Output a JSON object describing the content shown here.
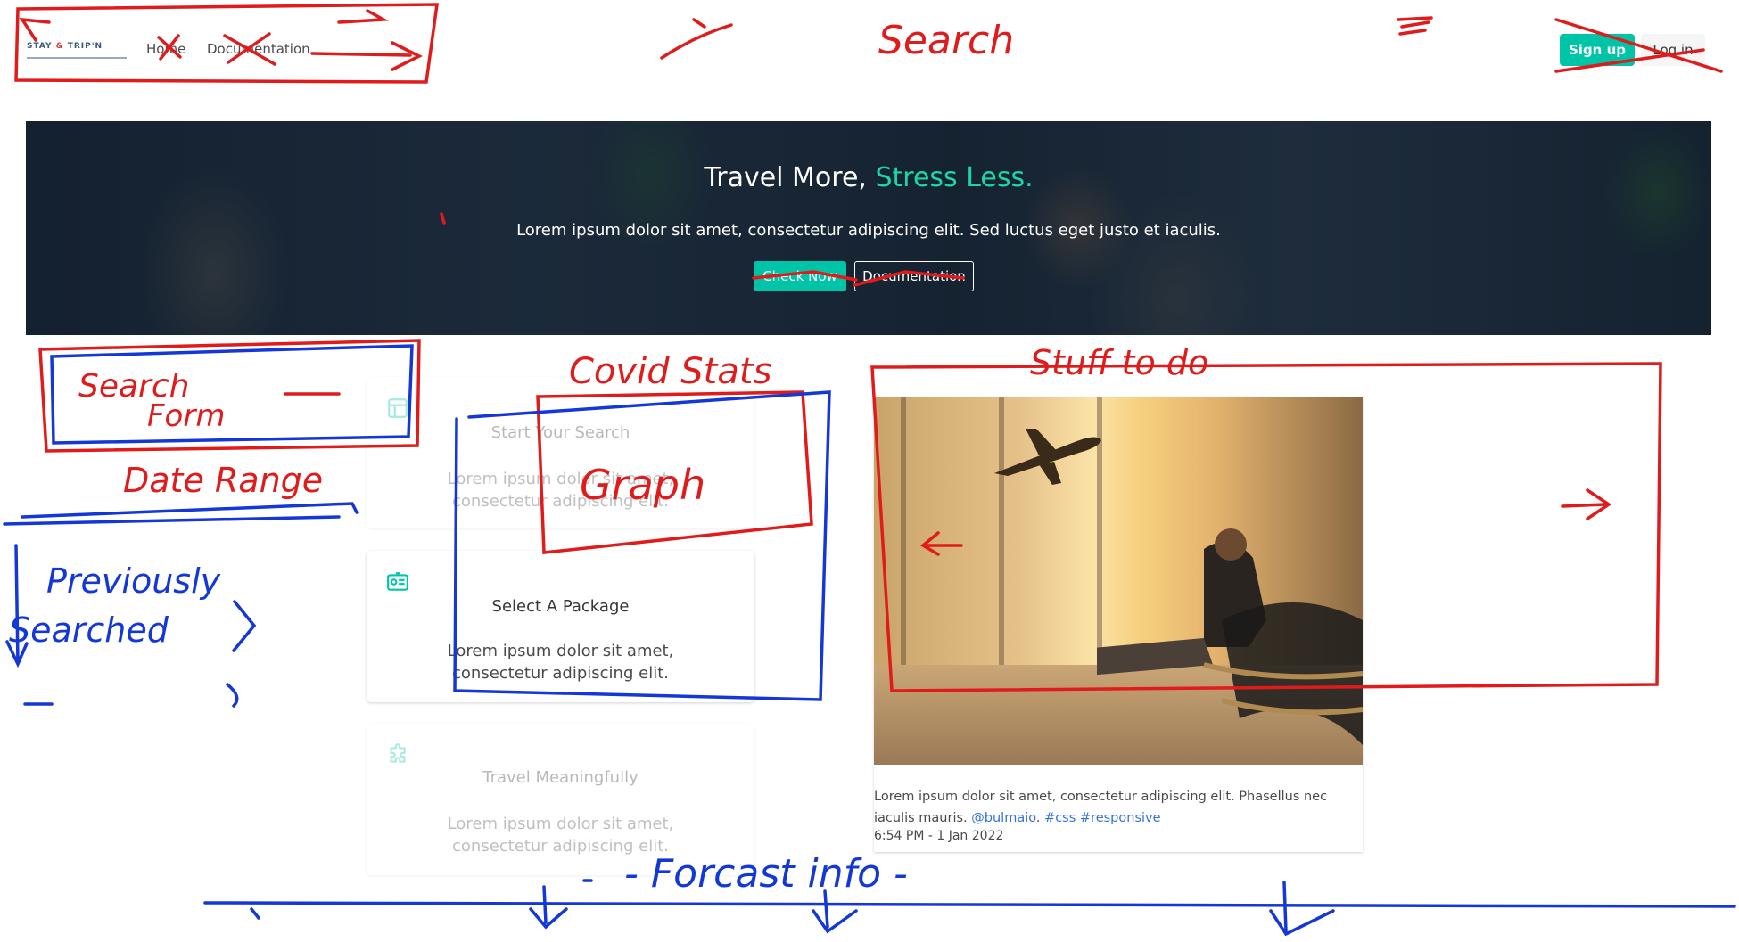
{
  "nav": {
    "logo_left": "STAY",
    "logo_mid": "&",
    "logo_right": "TRIP'N",
    "links": [
      "Home",
      "Documentation"
    ],
    "signup_label": "Sign up",
    "login_label": "Log in"
  },
  "hero": {
    "title_main": "Travel More, ",
    "title_accent": "Stress Less.",
    "subtitle": "Lorem ipsum dolor sit amet, consectetur adipiscing elit. Sed luctus eget justo et iaculis.",
    "check_label": "Check Now",
    "docs_label": "Documentation"
  },
  "cards": [
    {
      "title": "Start Your Search",
      "text": "Lorem ipsum dolor sit amet, consectetur adipiscing elit.",
      "icon": "layout-icon"
    },
    {
      "title": "Select A Package",
      "text": "Lorem ipsum dolor sit amet, consectetur adipiscing elit.",
      "icon": "id-card-icon"
    },
    {
      "title": "Travel Meaningfully",
      "text": "Lorem ipsum dolor sit amet, consectetur adipiscing elit.",
      "icon": "puzzle-icon"
    }
  ],
  "media": {
    "text": "Lorem ipsum dolor sit amet, consectetur adipiscing elit. Phasellus nec iaculis mauris.",
    "link_handle": "@bulmaio",
    "link_tag1": "#css",
    "link_tag2": "#responsive",
    "timestamp": "6:54 PM - 1 Jan 2022"
  },
  "annotations": {
    "search": "Search",
    "covid": "Covid Stats",
    "graph": "Graph",
    "stuff": "Stuff to do",
    "search_form_1": "Search",
    "search_form_2": "Form",
    "date_range": "Date Range",
    "previously": "Previously",
    "searched": "Searched",
    "forecast": "- Forcast info -"
  },
  "colors": {
    "accent": "#00c4a7",
    "hero_accent": "#1ed6a4",
    "link": "#3273dc",
    "ink_red": "#e01b1b",
    "ink_blue": "#1438d6"
  }
}
